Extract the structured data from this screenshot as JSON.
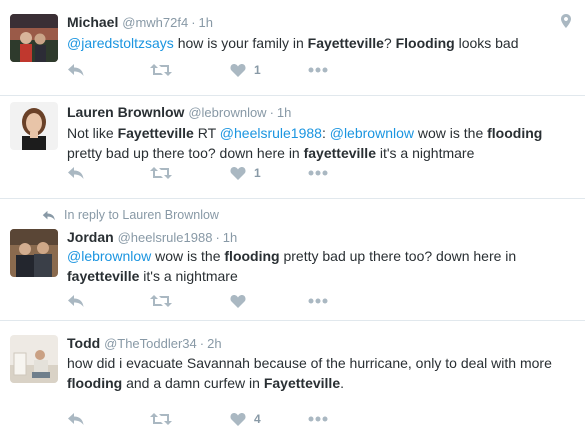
{
  "tweets": [
    {
      "name": "Michael",
      "handle": "@mwh72f4",
      "time": "1h",
      "mention": "@jaredstoltzsays",
      "t1": " how is your family in ",
      "b1": "Fayetteville",
      "t2": "? ",
      "b2": "Flooding",
      "t3": " looks bad",
      "likes": "1"
    },
    {
      "name": "Lauren Brownlow",
      "handle": "@lebrownlow",
      "time": "1h",
      "l1_t1": "Not like ",
      "l1_b1": "Fayetteville",
      "l1_t2": " RT ",
      "l1_m1": "@heelsrule1988",
      "l1_t3": ": ",
      "l1_m2": "@lebrownlow",
      "l1_t4": " wow is the ",
      "l1_b2": "flooding",
      "l2_t1": "pretty bad up there too? down here in ",
      "l2_b1": "fayetteville",
      "l2_t2": " it's a nightmare",
      "likes": "1"
    },
    {
      "reply_context": "In reply to Lauren Brownlow",
      "name": "Jordan",
      "handle": "@heelsrule1988",
      "time": "1h",
      "l1_m1": "@lebrownlow",
      "l1_t1": " wow is the ",
      "l1_b1": "flooding",
      "l1_t2": " pretty bad up there too? down here in",
      "l2_b1": "fayetteville",
      "l2_t1": " it's a nightmare"
    },
    {
      "name": "Todd",
      "handle": "@TheToddler34",
      "time": "2h",
      "l1_t1": "how did i evacuate Savannah because of the hurricane, only to deal with more",
      "l2_b1": "flooding",
      "l2_t1": " and a damn curfew in ",
      "l2_b2": "Fayetteville",
      "l2_t2": ".",
      "likes": "4"
    }
  ],
  "colors": {
    "link": "#1b95e0",
    "text": "#292f33",
    "muted": "#8899a6",
    "icon": "#aab8c2",
    "divider": "#e1e8ed"
  },
  "icons": [
    "reply-icon",
    "retweet-icon",
    "like-icon",
    "more-icon",
    "location-icon"
  ]
}
